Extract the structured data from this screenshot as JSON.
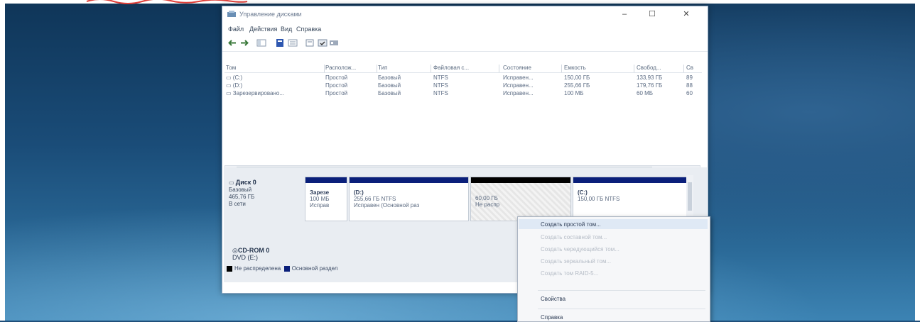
{
  "window": {
    "title": "Управление дисками",
    "controls": {
      "minimize": "–",
      "maximize": "☐",
      "close": "✕"
    }
  },
  "menu": [
    "Файл",
    "Действия",
    "Вид",
    "Справка"
  ],
  "volumes": {
    "columns": [
      "Том",
      "Располож...",
      "Тип",
      "Файловая с...",
      "Состояние",
      "Емкость",
      "Свобод...",
      "Св"
    ],
    "rows": [
      [
        "(C:)",
        "Простой",
        "Базовый",
        "NTFS",
        "Исправен...",
        "150,00 ГБ",
        "133,93 ГБ",
        "89"
      ],
      [
        "(D:)",
        "Простой",
        "Базовый",
        "NTFS",
        "Исправен...",
        "255,66 ГБ",
        "179,76 ГБ",
        "88"
      ],
      [
        "Зарезервировано...",
        "Простой",
        "Базовый",
        "NTFS",
        "Исправен...",
        "100 МБ",
        "60 МБ",
        "60"
      ]
    ]
  },
  "disk0": {
    "name": "Диск 0",
    "type": "Базовый",
    "size": "465,76 ГБ",
    "state": "В сети",
    "partitions": [
      {
        "name": "Зарезе",
        "size": "100 МБ",
        "status": "Исправ"
      },
      {
        "name": "(D:)",
        "size": "255,66 ГБ NTFS",
        "status": "Исправен (Основной раз"
      },
      {
        "name": "60,00 ГБ",
        "size": "Не распр",
        "status": ""
      },
      {
        "name": "(C:)",
        "size": "150,00 ГБ NTFS",
        "status": ""
      }
    ]
  },
  "cdrom": {
    "name": "CD-ROM 0",
    "type": "DVD (E:)"
  },
  "legend": [
    {
      "label": "Не распределена",
      "color": "#000000"
    },
    {
      "label": "Основной раздел",
      "color": "#0a1f7a"
    }
  ],
  "context_menu": {
    "items": [
      {
        "label": "Создать простой том...",
        "enabled": true
      },
      {
        "label": "Создать составной том...",
        "enabled": false
      },
      {
        "label": "Создать чередующийся том...",
        "enabled": false
      },
      {
        "label": "Создать зеркальный том...",
        "enabled": false
      },
      {
        "label": "Создать том RAID-5...",
        "enabled": false
      },
      {
        "label": "Свойства",
        "enabled": true
      },
      {
        "label": "Справка",
        "enabled": true
      }
    ]
  },
  "colors": {
    "accent": "#0a1f7a",
    "highlight": "#dfe9f5"
  }
}
